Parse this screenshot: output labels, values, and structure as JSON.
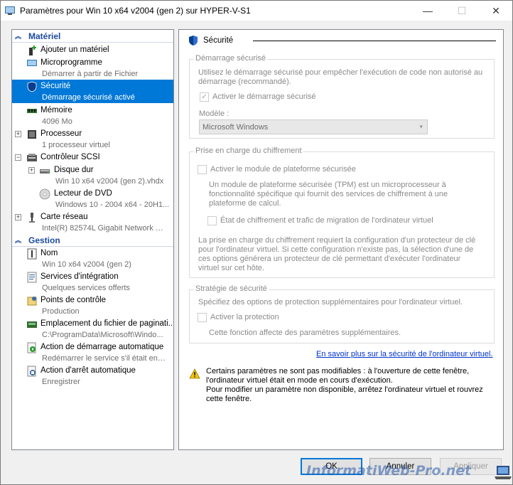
{
  "window": {
    "title": "Paramètres pour Win 10 x64 v2004 (gen 2) sur HYPER-V-S1",
    "minimize": "—",
    "maximize": "☐",
    "close": "✕"
  },
  "sidebar": {
    "sections": [
      {
        "label": "Matériel",
        "icon": "chevron-up-icon"
      },
      {
        "label": "Gestion",
        "icon": "chevron-up-icon"
      }
    ],
    "items": [
      {
        "label": "Ajouter un matériel",
        "sub": "",
        "icon": "add-hardware-icon"
      },
      {
        "label": "Microprogramme",
        "sub": "Démarrer à partir de Fichier",
        "icon": "firmware-icon"
      },
      {
        "label": "Sécurité",
        "sub": "Démarrage sécurisé activé",
        "icon": "shield-icon"
      },
      {
        "label": "Mémoire",
        "sub": "4096 Mo",
        "icon": "memory-icon"
      },
      {
        "label": "Processeur",
        "sub": "1 processeur virtuel",
        "icon": "processor-icon"
      },
      {
        "label": "Contrôleur SCSI",
        "sub": "",
        "icon": "scsi-controller-icon"
      },
      {
        "label": "Disque dur",
        "sub": "Win 10 x64 v2004 (gen 2).vhdx",
        "icon": "hard-disk-icon"
      },
      {
        "label": "Lecteur de DVD",
        "sub": "Windows 10 - 2004 x64 - 20H1...",
        "icon": "dvd-icon"
      },
      {
        "label": "Carte réseau",
        "sub": "Intel(R) 82574L Gigabit Network C...",
        "icon": "network-adapter-icon"
      },
      {
        "label": "Nom",
        "sub": "Win 10 x64 v2004 (gen 2)",
        "icon": "name-icon"
      },
      {
        "label": "Services d'intégration",
        "sub": "Quelques services offerts",
        "icon": "integration-services-icon"
      },
      {
        "label": "Points de contrôle",
        "sub": "Production",
        "icon": "checkpoint-icon"
      },
      {
        "label": "Emplacement du fichier de paginati...",
        "sub": "C:\\ProgramData\\Microsoft\\Windo...",
        "icon": "paging-file-icon"
      },
      {
        "label": "Action de démarrage automatique",
        "sub": "Redémarrer le service s'il était en c...",
        "icon": "auto-start-icon"
      },
      {
        "label": "Action d'arrêt automatique",
        "sub": "Enregistrer",
        "icon": "auto-stop-icon"
      }
    ],
    "expanders": {
      "collapsed": "+",
      "expanded": "−"
    }
  },
  "panel": {
    "title": "Sécurité",
    "secure_boot": {
      "legend": "Démarrage sécurisé",
      "description_1": "Utilisez le démarrage sécurisé pour empêcher l'exécution de code non autorisé au",
      "description_2": "démarrage (recommandé).",
      "checkbox_label": "Activer le démarrage sécurisé",
      "checkbox_mark": "✓",
      "template_label": "Modèle :",
      "template_value": "Microsoft Windows",
      "dropdown_arrow": "▾"
    },
    "encryption": {
      "legend": "Prise en charge du chiffrement",
      "tpm_label": "Activer le module de plateforme sécurisée",
      "tpm_desc_1": "Un module de plateforme sécurisée (TPM) est un microprocesseur à",
      "tpm_desc_2": "fonctionnalité spécifique qui fournit des services de chiffrement à une",
      "tpm_desc_3": "plateforme de calcul.",
      "state_label": "État de chiffrement et trafic de migration de l'ordinateur virtuel",
      "note_1": "La prise en charge du chiffrement requiert la configuration d'un protecteur de clé",
      "note_2": "pour l'ordinateur virtuel. Si cette configuration n'existe pas, la sélection d'une de",
      "note_3": "ces options générera un protecteur de clé permettant d'exécuter l'ordinateur",
      "note_4": "virtuel sur cet hôte."
    },
    "security_policy": {
      "legend": "Stratégie de sécurité",
      "description": "Spécifiez des options de protection supplémentaires pour l'ordinateur virtuel.",
      "checkbox_label": "Activer la protection",
      "note": "Cette fonction affecte des paramètres supplémentaires."
    },
    "learn_more": "En savoir plus sur la sécurité de l'ordinateur virtuel.",
    "warning": {
      "line_1": "Certains paramètres ne sont pas modifiables : à l'ouverture de cette fenêtre,",
      "line_2": "l'ordinateur virtuel était en mode en cours d'exécution.",
      "line_3": "Pour modifier un paramètre non disponible, arrêtez l'ordinateur virtuel et rouvrez",
      "line_4": "cette fenêtre."
    }
  },
  "buttons": {
    "ok": "OK",
    "cancel": "Annuler",
    "apply": "Appliquer"
  },
  "watermark": "InformatiWeb-Pro.net",
  "colors": {
    "selection": "#0078d7",
    "section_header": "#1c4ba0",
    "link": "#0033cc"
  }
}
